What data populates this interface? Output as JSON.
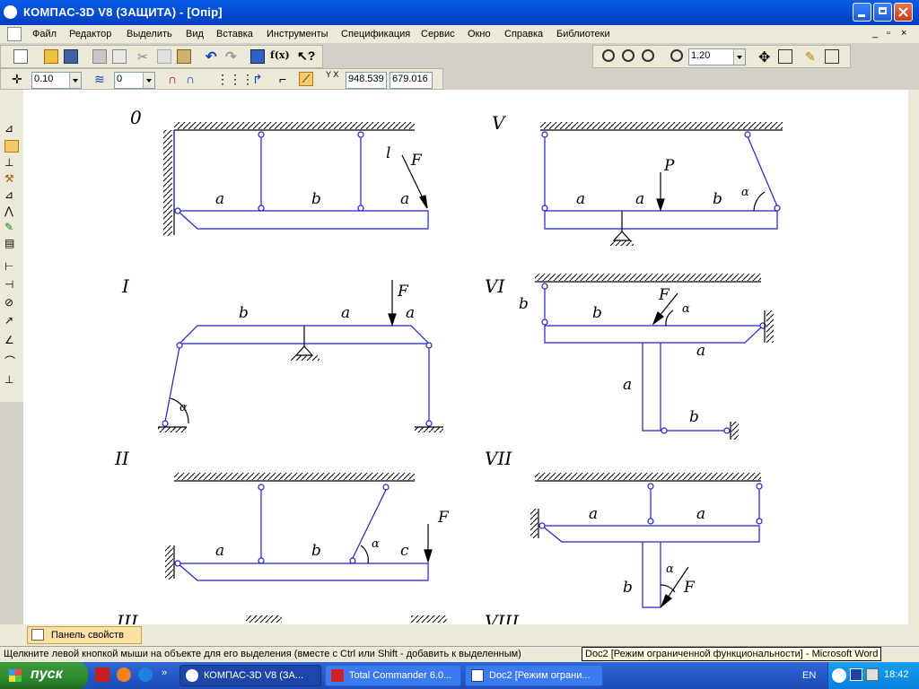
{
  "window": {
    "title": "КОМПАС-3D V8 (ЗАЩИТА) - [Опір]"
  },
  "menu": [
    "Файл",
    "Редактор",
    "Выделить",
    "Вид",
    "Вставка",
    "Инструменты",
    "Спецификация",
    "Сервис",
    "Окно",
    "Справка",
    "Библиотеки"
  ],
  "toolbar": {
    "scale_value": "1.20",
    "step_value": "0.10",
    "layer_value": "0",
    "coord_x": "948.539",
    "coord_y": "679.016",
    "coord_label": "Y X",
    "fx_label": "f(x)"
  },
  "drawing": {
    "schemes": [
      {
        "numeral": "0",
        "labels": [
          "a",
          "b",
          "a",
          "l",
          "F"
        ]
      },
      {
        "numeral": "V",
        "labels": [
          "a",
          "a",
          "b",
          "P",
          "α"
        ]
      },
      {
        "numeral": "I",
        "labels": [
          "b",
          "a",
          "a",
          "F",
          "α"
        ]
      },
      {
        "numeral": "VI",
        "labels": [
          "b",
          "b",
          "F",
          "α",
          "a",
          "a",
          "b"
        ]
      },
      {
        "numeral": "II",
        "labels": [
          "a",
          "b",
          "c",
          "F",
          "α"
        ]
      },
      {
        "numeral": "VII",
        "labels": [
          "a",
          "a",
          "b",
          "F",
          "α"
        ]
      },
      {
        "numeral": "III",
        "labels": []
      },
      {
        "numeral": "VIII",
        "labels": []
      }
    ]
  },
  "property_panel": {
    "tab_label": "Панель свойств"
  },
  "status": {
    "hint": "Щелкните левой кнопкой мыши на объекте для его выделения (вместе с Ctrl или Shift - добавить к выделенным)",
    "tooltip": "Doc2 [Режим ограниченной функциональности] - Microsoft Word"
  },
  "taskbar": {
    "start_label": "пуск",
    "tasks": [
      "КОМПАС-3D V8 (ЗА...",
      "Total Commander 6.0...",
      "Doc2 [Режим ограни..."
    ],
    "lang": "EN",
    "clock": "18:42"
  },
  "colors": {
    "line": "#2020c8",
    "hatch": "#000000",
    "title": "#0450d6"
  }
}
